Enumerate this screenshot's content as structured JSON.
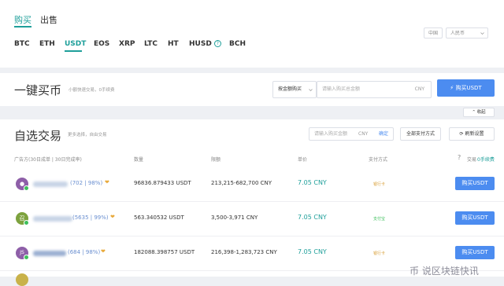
{
  "top": {
    "tabs": [
      {
        "label": "购买"
      },
      {
        "label": "出售"
      }
    ],
    "coins": [
      {
        "label": "BTC"
      },
      {
        "label": "ETH"
      },
      {
        "label": "USDT"
      },
      {
        "label": "EOS"
      },
      {
        "label": "XRP"
      },
      {
        "label": "LTC"
      },
      {
        "label": "HT"
      },
      {
        "label": "HUSD"
      },
      {
        "label": "BCH"
      }
    ],
    "info_glyph": "?",
    "region_select": "中国",
    "currency_select": "人民币"
  },
  "quick": {
    "title": "一键买币",
    "subtitle": "小额快速交易，0手续费",
    "mode_select": "按金额购买",
    "amount_placeholder": "请输入购买总金额",
    "currency_unit": "CNY",
    "buy_label": "购买USDT",
    "collapse_label": "收起"
  },
  "orders": {
    "title": "自选交易",
    "subtitle": "更多选择，自由交易",
    "amount_placeholder": "请输入购买金额",
    "currency_unit": "CNY",
    "confirm_label": "确定",
    "payment_filter": "全部支付方式",
    "refresh_label": "刷新设置",
    "headers": {
      "advertiser": "广告方(30日成单 | 30日完成率)",
      "quantity": "数量",
      "limit": "限额",
      "price": "单价",
      "payment": "支付方式",
      "trade": "交易",
      "fee": "0手续费"
    },
    "rows": [
      {
        "stats": "(702 | 98%)",
        "quantity": "96836.879433 USDT",
        "limit": "213,215-682,700 CNY",
        "price": "7.05 CNY",
        "payment": "银行卡",
        "buy": "购买USDT",
        "avatar_color": "#8e5fa8",
        "avatar_letter": "●",
        "pay_color": "#d9a03a"
      },
      {
        "stats": "(5635 | 99%)",
        "quantity": "563.340532 USDT",
        "limit": "3,500-3,971 CNY",
        "price": "7.05 CNY",
        "payment": "支付宝",
        "buy": "购买USDT",
        "avatar_color": "#7da23e",
        "avatar_letter": "召",
        "pay_color": "#3dbf5b"
      },
      {
        "stats": "(684 | 98%)",
        "quantity": "182088.398757 USDT",
        "limit": "216,398-1,283,723 CNY",
        "price": "7.05 CNY",
        "payment": "银行卡",
        "buy": "购买USDT",
        "avatar_color": "#8e5fa8",
        "avatar_letter": "JS",
        "pay_color": "#d9a03a"
      }
    ]
  },
  "watermark": "币 说区块链快讯"
}
